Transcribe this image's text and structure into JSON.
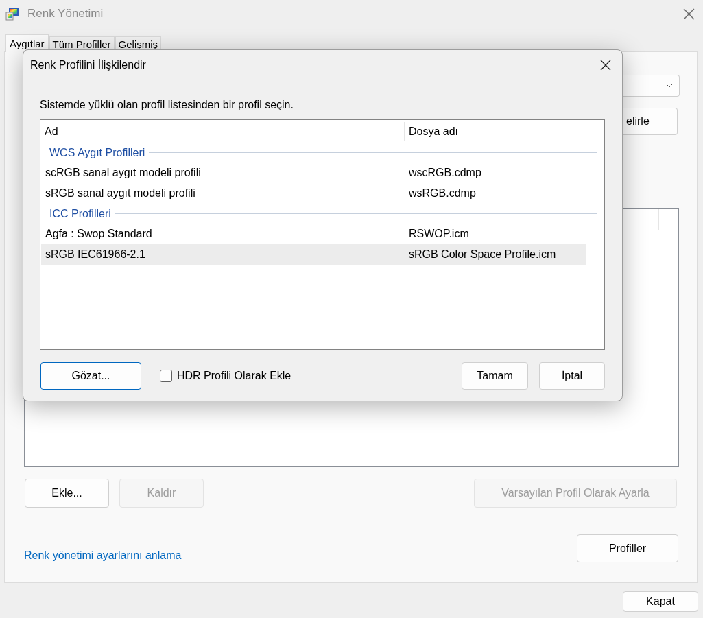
{
  "window": {
    "title": "Renk Yönetimi"
  },
  "tabs": [
    {
      "label": "Aygıtlar",
      "selected": true
    },
    {
      "label": "Tüm Profiller",
      "selected": false
    },
    {
      "label": "Gelişmiş",
      "selected": false
    }
  ],
  "devices_tab": {
    "identify_button": {
      "label": "elirle"
    },
    "actions": [
      {
        "label": "Ekle...",
        "disabled": false
      },
      {
        "label": "Kaldır",
        "disabled": true
      },
      {
        "label": "Varsayılan Profil Olarak Ayarla",
        "disabled": true
      }
    ],
    "help_link": "Renk yönetimi ayarlarını anlama",
    "profiles_button": "Profiller"
  },
  "close_button": "Kapat",
  "dialog": {
    "title": "Renk Profilini İlişkilendir",
    "instruction": "Sistemde yüklü olan profil listesinden bir profil seçin.",
    "profile_list": {
      "columns": [
        "Ad",
        "Dosya adı"
      ],
      "groups": [
        {
          "name": "WCS Aygıt Profilleri",
          "rows": [
            {
              "name": "scRGB sanal aygıt modeli profili",
              "file": "wscRGB.cdmp",
              "selected": false
            },
            {
              "name": "sRGB sanal aygıt modeli profili",
              "file": "wsRGB.cdmp",
              "selected": false
            }
          ]
        },
        {
          "name": "ICC Profilleri",
          "rows": [
            {
              "name": "Agfa : Swop Standard",
              "file": "RSWOP.icm",
              "selected": false
            },
            {
              "name": "sRGB IEC61966-2.1",
              "file": "sRGB Color Space Profile.icm",
              "selected": true
            }
          ]
        }
      ]
    },
    "browse_button": {
      "label": "Gözat...",
      "focused": true
    },
    "hdr_checkbox": {
      "label": "HDR Profili Olarak Ekle",
      "checked": false
    },
    "buttons": [
      "Tamam",
      "İptal"
    ]
  }
}
